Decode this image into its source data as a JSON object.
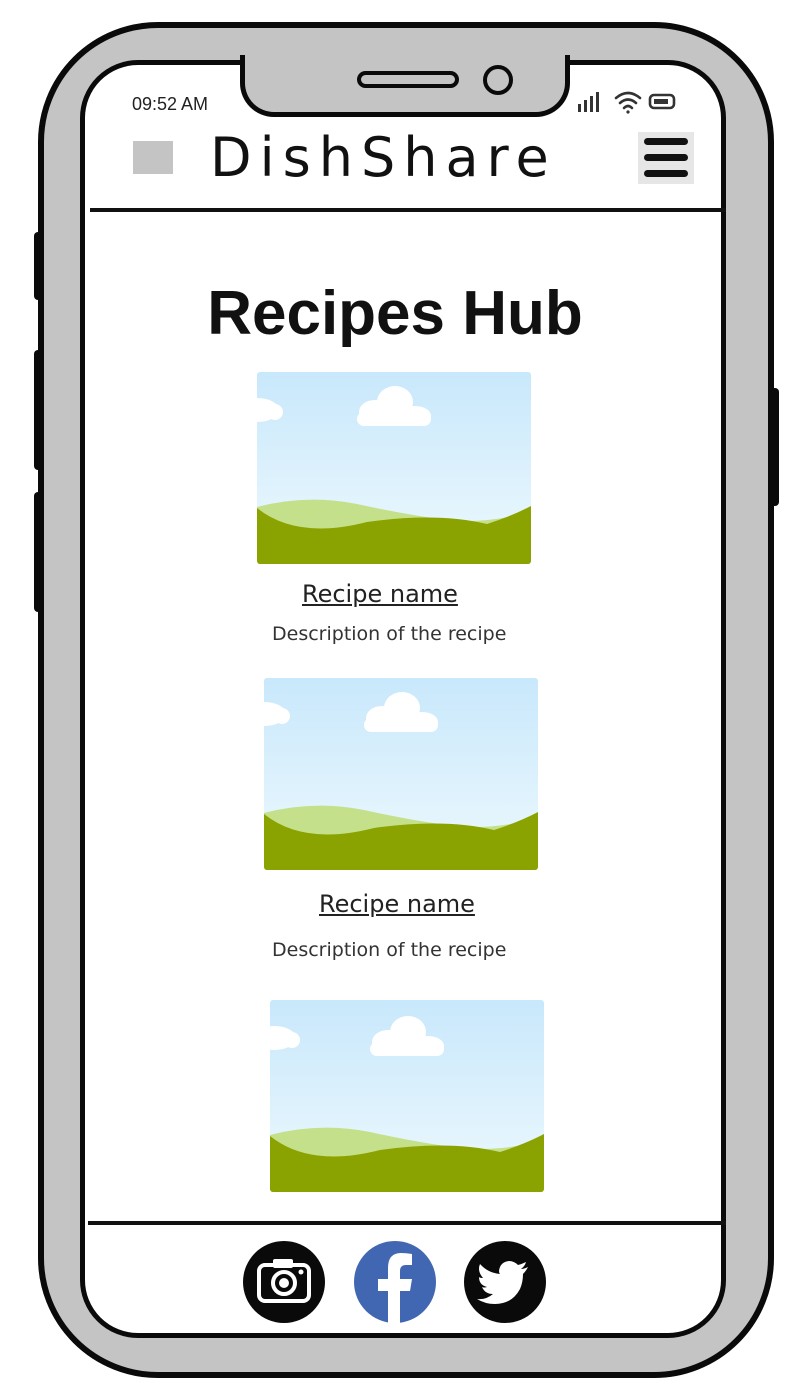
{
  "status_bar": {
    "time": "09:52 AM",
    "icons": [
      "signal-icon",
      "wifi-icon",
      "battery-icon"
    ]
  },
  "header": {
    "logo_placeholder": "logo-placeholder",
    "brand": "DishShare",
    "menu_icon": "hamburger-menu-icon"
  },
  "main": {
    "title": "Recipes Hub",
    "recipes": [
      {
        "name": "Recipe name",
        "description": "Description of the recipe",
        "image": "landscape-image-placeholder"
      },
      {
        "name": "Recipe name",
        "description": "Description of the recipe",
        "image": "landscape-image-placeholder"
      },
      {
        "image": "landscape-image-placeholder"
      }
    ]
  },
  "footer": {
    "social": [
      {
        "icon": "camera-icon"
      },
      {
        "icon": "facebook-icon"
      },
      {
        "icon": "twitter-icon"
      }
    ]
  },
  "colors": {
    "phone_frame": "#c4c4c4",
    "outline": "#0a0a0a",
    "sky_top": "#c8e8fb",
    "sky_bottom": "#eaf7fd",
    "hill_light": "#c5e08a",
    "hill_dark": "#8ba300",
    "facebook_blue": "#4267b2"
  }
}
